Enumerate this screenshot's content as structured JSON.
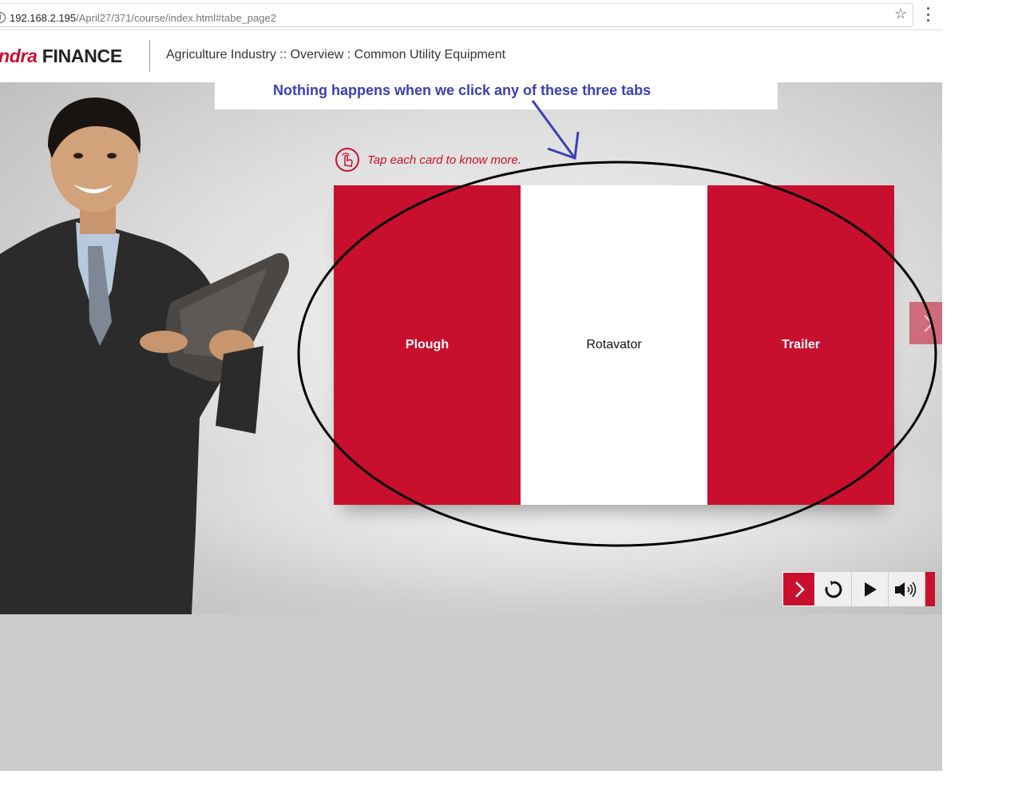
{
  "browser": {
    "url_host": "192.168.2.195",
    "url_path": "/April27/371/course/index.html#tabe_page2"
  },
  "header": {
    "brand_left": "ndra",
    "brand_right": "FINANCE",
    "breadcrumb": "Agriculture Industry :: Overview : Common Utility Equipment"
  },
  "annotation": {
    "text": "Nothing happens when we click any of these three tabs"
  },
  "hint": {
    "text": "Tap each card to know more."
  },
  "cards": [
    {
      "label": "Plough",
      "style": "red"
    },
    {
      "label": "Rotavator",
      "style": "white"
    },
    {
      "label": "Trailer",
      "style": "red"
    }
  ],
  "colors": {
    "brand_red": "#c8102e",
    "annotation_blue": "#3b3fb5"
  }
}
